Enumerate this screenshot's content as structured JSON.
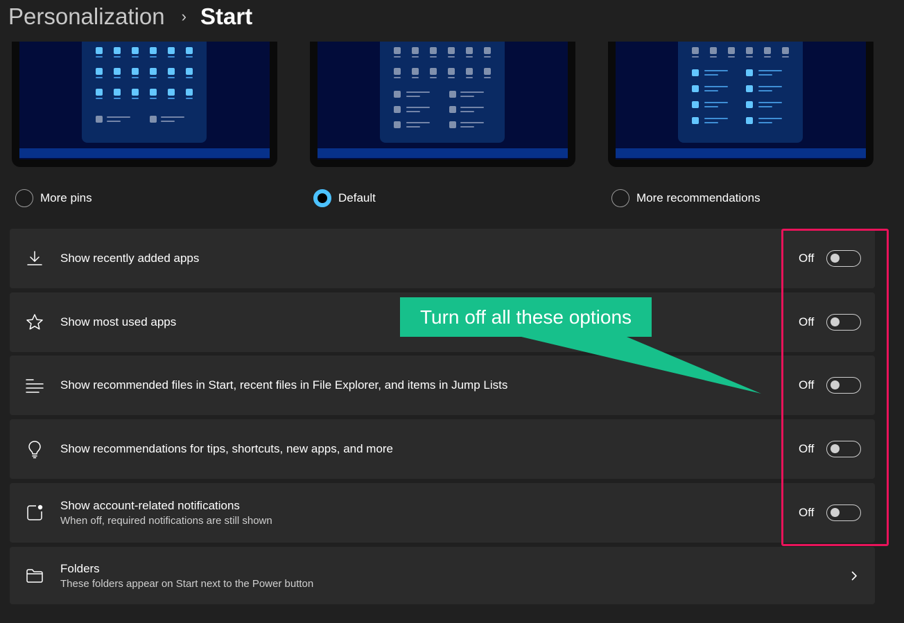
{
  "header": {
    "parent": "Personalization",
    "separator": "›",
    "current": "Start"
  },
  "layouts": [
    {
      "label": "More pins",
      "selected": false
    },
    {
      "label": "Default",
      "selected": true
    },
    {
      "label": "More recommendations",
      "selected": false
    }
  ],
  "settings": [
    {
      "icon": "download-icon",
      "title": "Show recently added apps",
      "state": "Off"
    },
    {
      "icon": "star-icon",
      "title": "Show most used apps",
      "state": "Off"
    },
    {
      "icon": "list-icon",
      "title": "Show recommended files in Start, recent files in File Explorer, and items in Jump Lists",
      "state": "Off"
    },
    {
      "icon": "lightbulb-icon",
      "title": "Show recommendations for tips, shortcuts, new apps, and more",
      "state": "Off"
    },
    {
      "icon": "notification-icon",
      "title": "Show account-related notifications",
      "subtitle": "When off, required notifications are still shown",
      "state": "Off"
    }
  ],
  "folders": {
    "icon": "folder-icon",
    "title": "Folders",
    "subtitle": "These folders appear on Start next to the Power button"
  },
  "annotation": {
    "callout": "Turn off all these options"
  },
  "colors": {
    "accent": "#4cc2ff",
    "callout": "#17c08b",
    "highlight": "#e8135a",
    "card": "#2b2b2b",
    "background": "#202020"
  }
}
